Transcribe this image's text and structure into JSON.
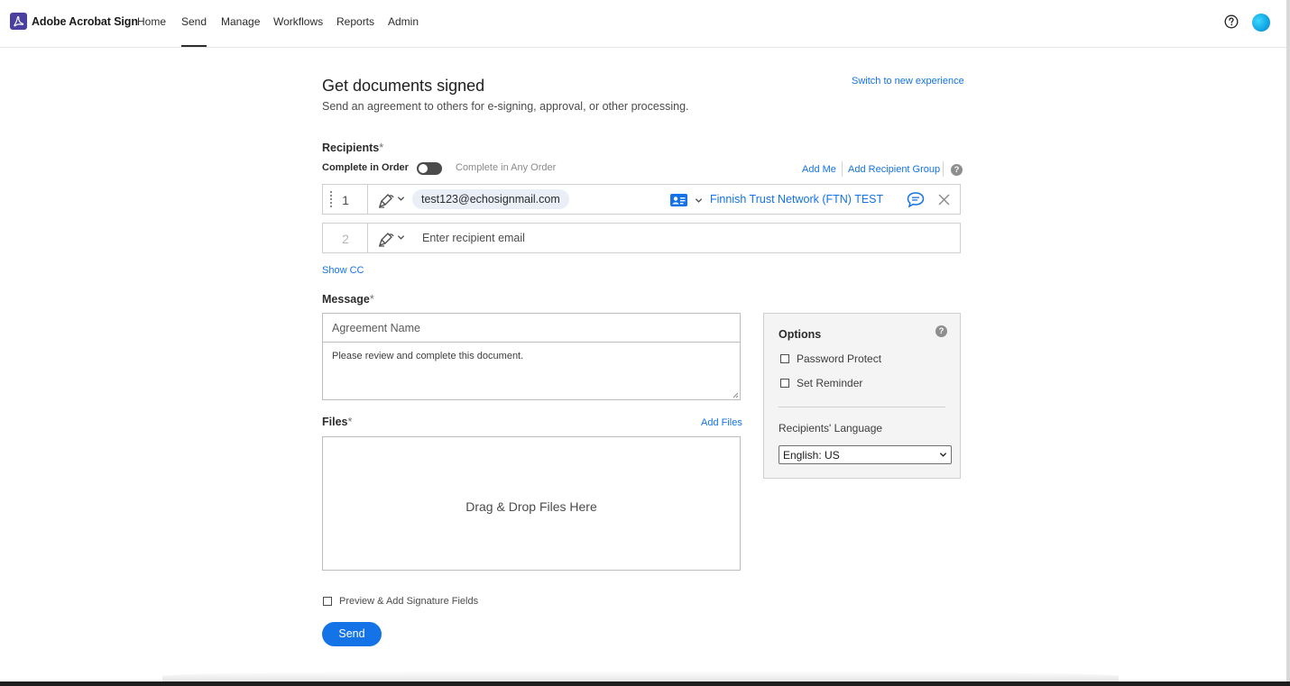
{
  "app": {
    "brand": "Adobe Acrobat Sign",
    "nav": [
      "Home",
      "Send",
      "Manage",
      "Workflows",
      "Reports",
      "Admin"
    ],
    "active_nav": "Send"
  },
  "header": {
    "title": "Get documents signed",
    "subtitle": "Send an agreement to others for e-signing, approval, or other processing.",
    "switch_link": "Switch to new experience"
  },
  "recipients": {
    "label": "Recipients",
    "required_mark": "*",
    "order_on_label": "Complete in Order",
    "order_off_label": "Complete in Any Order",
    "add_me": "Add Me",
    "add_group": "Add Recipient Group",
    "rows": [
      {
        "number": "1",
        "email": "test123@echosignmail.com",
        "auth": "Finnish Trust Network (FTN) TEST"
      },
      {
        "number": "2",
        "placeholder": "Enter recipient email"
      }
    ],
    "show_cc": "Show CC"
  },
  "message": {
    "label": "Message",
    "required_mark": "*",
    "agreement_name_placeholder": "Agreement Name",
    "body": "Please review and complete this document."
  },
  "files": {
    "label": "Files",
    "required_mark": "*",
    "add_files": "Add Files",
    "drop_text": "Drag & Drop Files Here"
  },
  "options": {
    "title": "Options",
    "password_protect": "Password Protect",
    "set_reminder": "Set Reminder",
    "language_label": "Recipients' Language",
    "language_value": "English: US"
  },
  "footer": {
    "preview_label": "Preview & Add Signature Fields",
    "send_label": "Send"
  },
  "colors": {
    "accent": "#1473e6",
    "brand_logo": "#4b3f9f",
    "options_bg": "#f4f4f4"
  },
  "icons": [
    "acrobat-logo-icon",
    "help-icon",
    "avatar",
    "drag-handle-icon",
    "signer-pen-icon",
    "chevron-down-icon",
    "auth-id-card-icon",
    "message-bubble-icon",
    "close-icon",
    "question-icon"
  ]
}
